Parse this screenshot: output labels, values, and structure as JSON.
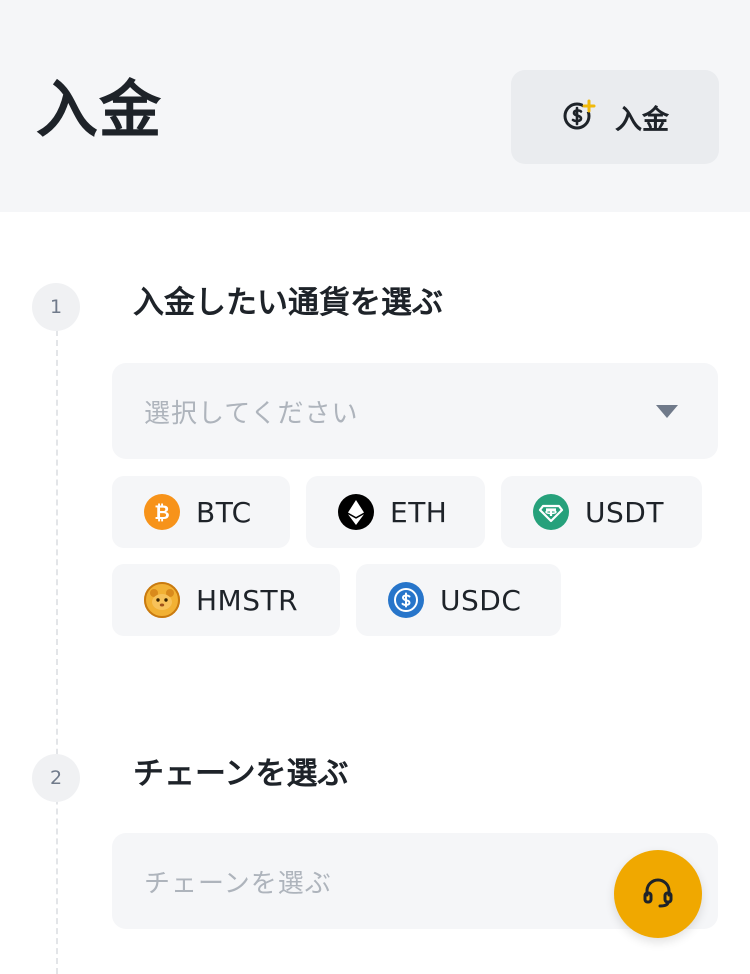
{
  "header": {
    "title": "入金",
    "deposit_button_label": "入金",
    "deposit_button_icon": "coin-plus-icon"
  },
  "steps": [
    {
      "number": "1",
      "title": "入金したい通貨を選ぶ",
      "select_placeholder": "選択してください",
      "coins": [
        {
          "symbol": "BTC",
          "icon": "bitcoin-icon",
          "color": "#f7931a"
        },
        {
          "symbol": "ETH",
          "icon": "ethereum-icon",
          "color": "#000000"
        },
        {
          "symbol": "USDT",
          "icon": "tether-icon",
          "color": "#26a17b"
        },
        {
          "symbol": "HMSTR",
          "icon": "hamster-icon",
          "color": "#e8a21a"
        },
        {
          "symbol": "USDC",
          "icon": "usdc-icon",
          "color": "#2775ca"
        }
      ]
    },
    {
      "number": "2",
      "title": "チェーンを選ぶ",
      "select_placeholder": "チェーンを選ぶ"
    }
  ],
  "support": {
    "icon": "headset-icon",
    "color": "#f0a800"
  }
}
